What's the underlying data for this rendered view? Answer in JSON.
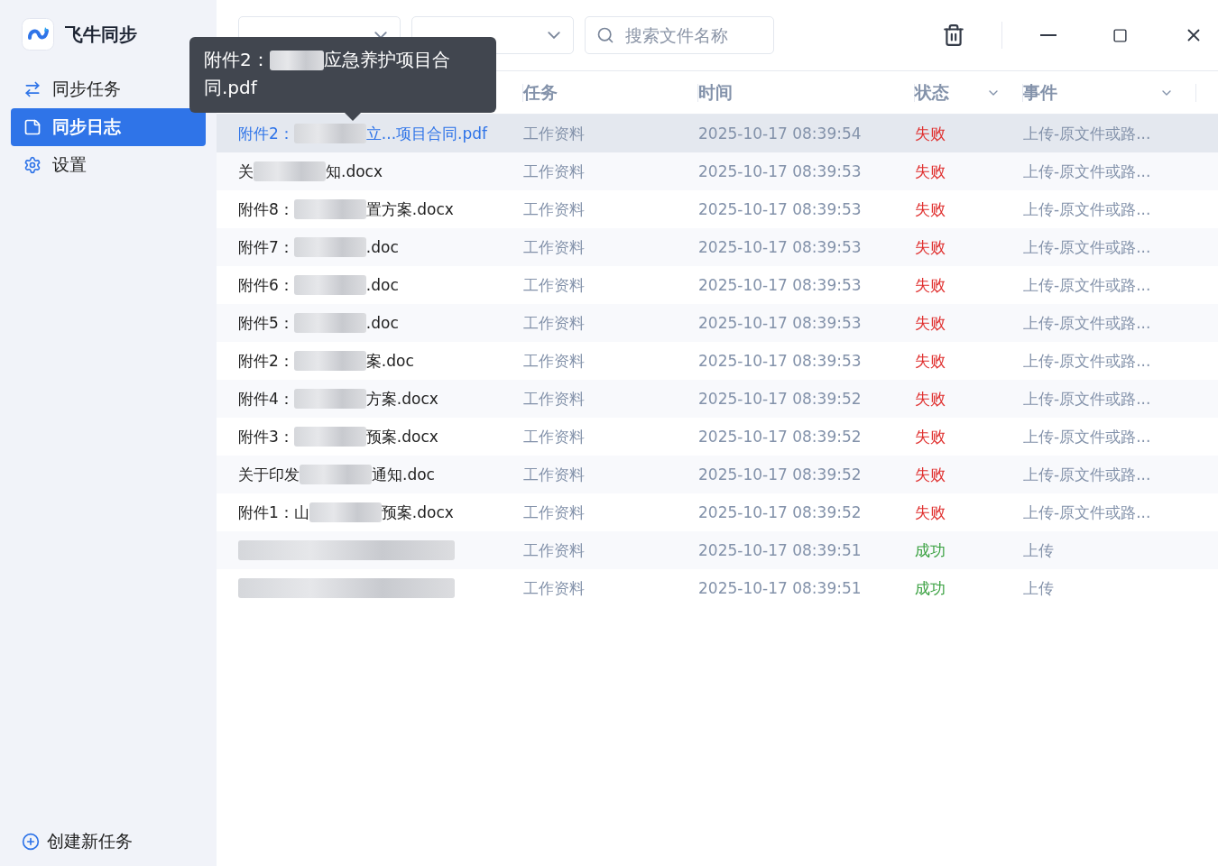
{
  "app": {
    "name": "飞牛同步"
  },
  "sidebar": {
    "items": [
      {
        "label": "同步任务",
        "selected": false
      },
      {
        "label": "同步日志",
        "selected": true
      },
      {
        "label": "设置",
        "selected": false
      }
    ],
    "create_button": "创建新任务"
  },
  "toolbar": {
    "search": {
      "placeholder": "搜索文件名称"
    }
  },
  "table": {
    "columns": [
      {
        "label": "任务"
      },
      {
        "label": "时间"
      },
      {
        "label": "状态",
        "dropdown": true
      },
      {
        "label": "事件",
        "dropdown": true
      }
    ],
    "rows": [
      {
        "name_start": "附件2：",
        "name_end": "立...项目合同.pdf",
        "task": "工作资料",
        "time": "2025-10-17 08:39:54",
        "status": "失败",
        "kind": "failed",
        "event": "上传-原文件或路...",
        "selected": true
      },
      {
        "name_start": "关",
        "name_end": "知.docx",
        "task": "工作资料",
        "time": "2025-10-17 08:39:53",
        "status": "失败",
        "kind": "failed",
        "event": "上传-原文件或路...",
        "selected": false
      },
      {
        "name_start": "附件8：",
        "name_end": "置方案.docx",
        "task": "工作资料",
        "time": "2025-10-17 08:39:53",
        "status": "失败",
        "kind": "failed",
        "event": "上传-原文件或路...",
        "selected": false
      },
      {
        "name_start": "附件7：",
        "name_end": ".doc",
        "task": "工作资料",
        "time": "2025-10-17 08:39:53",
        "status": "失败",
        "kind": "failed",
        "event": "上传-原文件或路...",
        "selected": false
      },
      {
        "name_start": "附件6：",
        "name_end": ".doc",
        "task": "工作资料",
        "time": "2025-10-17 08:39:53",
        "status": "失败",
        "kind": "failed",
        "event": "上传-原文件或路...",
        "selected": false
      },
      {
        "name_start": "附件5：",
        "name_end": ".doc",
        "task": "工作资料",
        "time": "2025-10-17 08:39:53",
        "status": "失败",
        "kind": "failed",
        "event": "上传-原文件或路...",
        "selected": false
      },
      {
        "name_start": "附件2：",
        "name_end": "案.doc",
        "task": "工作资料",
        "time": "2025-10-17 08:39:53",
        "status": "失败",
        "kind": "failed",
        "event": "上传-原文件或路...",
        "selected": false
      },
      {
        "name_start": "附件4：",
        "name_end": "方案.docx",
        "task": "工作资料",
        "time": "2025-10-17 08:39:52",
        "status": "失败",
        "kind": "failed",
        "event": "上传-原文件或路...",
        "selected": false
      },
      {
        "name_start": "附件3：",
        "name_end": "预案.docx",
        "task": "工作资料",
        "time": "2025-10-17 08:39:52",
        "status": "失败",
        "kind": "failed",
        "event": "上传-原文件或路...",
        "selected": false
      },
      {
        "name_start": "关于印发",
        "name_end": "通知.doc",
        "task": "工作资料",
        "time": "2025-10-17 08:39:52",
        "status": "失败",
        "kind": "failed",
        "event": "上传-原文件或路...",
        "selected": false
      },
      {
        "name_start": "附件1：山",
        "name_end": "预案.docx",
        "task": "工作资料",
        "time": "2025-10-17 08:39:52",
        "status": "失败",
        "kind": "failed",
        "event": "上传-原文件或路...",
        "selected": false
      },
      {
        "task": "工作资料",
        "time": "2025-10-17 08:39:51",
        "status": "成功",
        "kind": "success",
        "event": "上传",
        "selected": false
      },
      {
        "task": "工作资料",
        "time": "2025-10-17 08:39:51",
        "status": "成功",
        "kind": "success",
        "event": "上传",
        "selected": false
      }
    ]
  },
  "tooltip": {
    "text_start": "附件2：",
    "text_mid": "应急养护项目合",
    "text_end": "同.pdf"
  }
}
